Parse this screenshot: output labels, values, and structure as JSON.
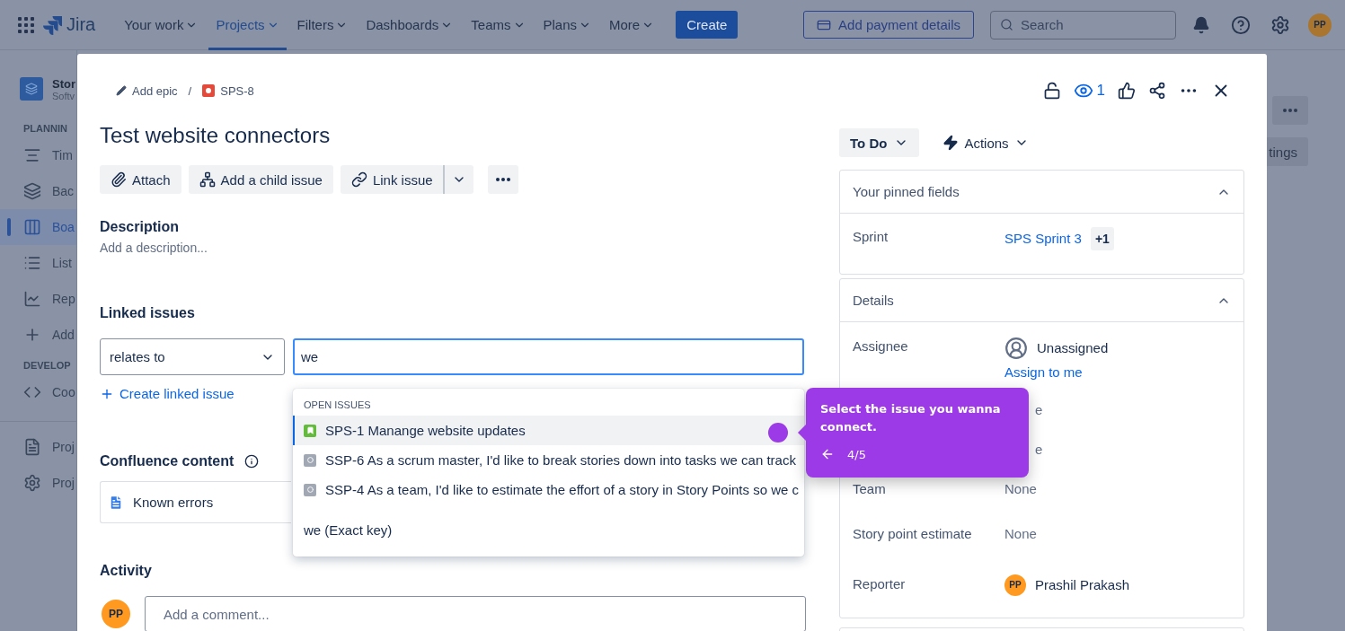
{
  "top_nav": {
    "product": "Jira",
    "items": [
      {
        "label": "Your work",
        "selected": false
      },
      {
        "label": "Projects",
        "selected": true
      },
      {
        "label": "Filters",
        "selected": false
      },
      {
        "label": "Dashboards",
        "selected": false
      },
      {
        "label": "Teams",
        "selected": false
      },
      {
        "label": "Plans",
        "selected": false
      },
      {
        "label": "More",
        "selected": false
      }
    ],
    "create": "Create",
    "payment": "Add payment details",
    "search": {
      "placeholder": "Search"
    },
    "avatar": "PP"
  },
  "sidebar": {
    "project_name": "Stor",
    "project_type": "Softv",
    "sections": [
      {
        "title": "PLANNIN",
        "items": [
          {
            "label": "Tim",
            "selected": false
          },
          {
            "label": "Bac",
            "selected": false
          },
          {
            "label": "Boa",
            "selected": true
          },
          {
            "label": "List",
            "selected": false
          },
          {
            "label": "Rep",
            "selected": false
          },
          {
            "label": "Add",
            "selected": false
          }
        ]
      },
      {
        "title": "DEVELOP",
        "items": [
          {
            "label": "Coo",
            "selected": false
          }
        ]
      },
      {
        "items": [
          {
            "label": "Proj",
            "selected": false
          },
          {
            "label": "Proj",
            "selected": false
          }
        ]
      }
    ]
  },
  "page_behind": {
    "settings_button": "tings"
  },
  "issue_modal": {
    "breadcrumb": {
      "epic": "Add epic",
      "separator": "/",
      "issue_key": "SPS-8"
    },
    "watchers": "1",
    "title": "Test website connectors",
    "toolbar": [
      {
        "label": "Attach"
      },
      {
        "label": "Add a child issue"
      },
      {
        "label": "Link issue"
      }
    ],
    "description": {
      "heading": "Description",
      "placeholder": "Add a description..."
    },
    "linked_issues": {
      "heading": "Linked issues",
      "link_type": "relates to",
      "search": {
        "value": "we"
      },
      "create": "Create linked issue",
      "suggestions": {
        "group": "OPEN ISSUES",
        "items": [
          {
            "kind": "story",
            "text": "SPS-1 Manange website updates",
            "selected": true
          },
          {
            "kind": "task",
            "text": "SSP-6 As a scrum master, I'd like to break stories down into tasks we can track",
            "selected": false
          },
          {
            "kind": "task",
            "text": "SSP-4 As a team, I'd like to estimate the effort of a story in Story Points so we c",
            "selected": false
          }
        ],
        "exact": "we (Exact key)"
      }
    },
    "confluence": {
      "heading": "Confluence content",
      "items": [
        {
          "title": "Known errors"
        }
      ]
    },
    "activity": {
      "heading": "Activity",
      "avatar": "PP",
      "comment": {
        "placeholder": "Add a comment..."
      }
    },
    "status": "To Do",
    "actions": "Actions",
    "pinned_fields": {
      "title": "Your pinned fields",
      "expanded": true,
      "fields": [
        {
          "label": "Sprint",
          "value": "SPS Sprint 3",
          "extra": "+1"
        }
      ]
    },
    "details": {
      "title": "Details",
      "expanded": true,
      "fields": [
        {
          "kind": "unassigned",
          "label": "Assignee",
          "value": "Unassigned",
          "link": "Assign to me"
        },
        {
          "kind": "partial",
          "value": "e"
        },
        {
          "kind": "partial",
          "value": "e"
        },
        {
          "kind": "text",
          "label": "Team",
          "value": "None"
        },
        {
          "kind": "text",
          "label": "Story point estimate",
          "value": "None"
        },
        {
          "kind": "person",
          "label": "Reporter",
          "value": "Prashil Prakash",
          "avatar": "PP"
        }
      ]
    }
  },
  "tour_tooltip": {
    "text": "Select the issue you wanna connect.",
    "step": "4/5"
  }
}
